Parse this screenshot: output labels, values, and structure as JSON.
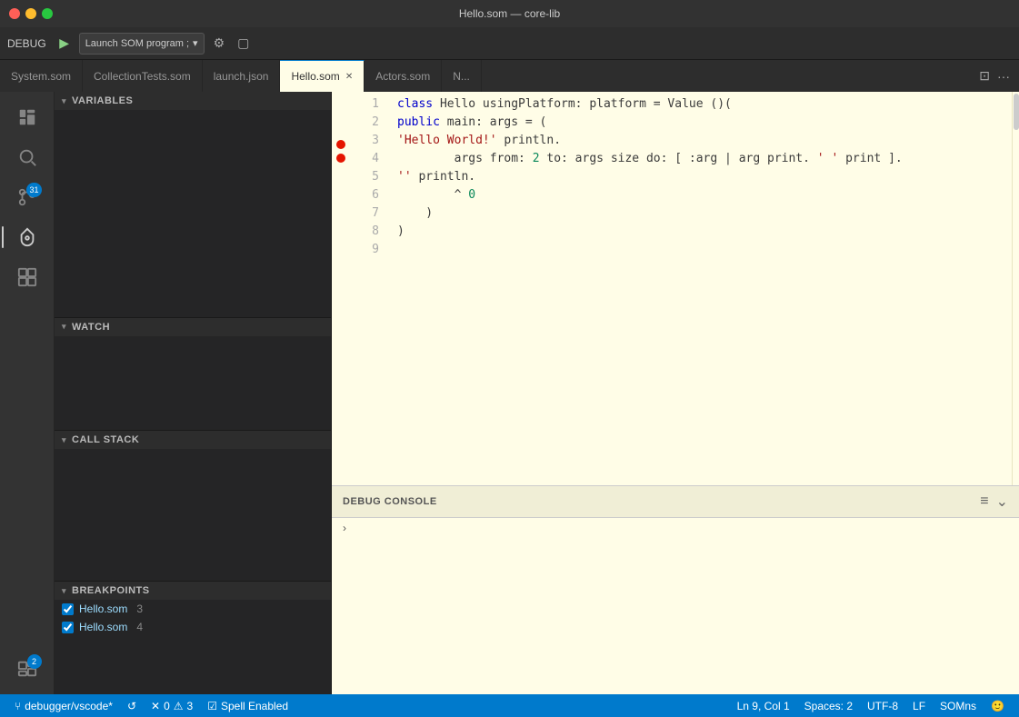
{
  "window": {
    "title": "Hello.som — core-lib"
  },
  "titlebar": {
    "buttons": [
      "close",
      "minimize",
      "maximize"
    ]
  },
  "toolbar": {
    "debug_label": "DEBUG",
    "config_name": "Launch SOM program ;",
    "gear_icon": "⚙",
    "layout_icon": "⊡"
  },
  "tabs": [
    {
      "id": "system",
      "label": "System.som",
      "active": false,
      "dirty": false
    },
    {
      "id": "collection",
      "label": "CollectionTests.som",
      "active": false,
      "dirty": false
    },
    {
      "id": "launch",
      "label": "launch.json",
      "active": false,
      "dirty": false
    },
    {
      "id": "hello",
      "label": "Hello.som",
      "active": true,
      "dirty": false
    },
    {
      "id": "actors",
      "label": "Actors.som",
      "active": false,
      "dirty": false
    },
    {
      "id": "more",
      "label": "N...",
      "active": false,
      "dirty": false
    }
  ],
  "sidebar": {
    "icons": [
      {
        "id": "explorer",
        "symbol": "⬜",
        "active": false,
        "badge": null
      },
      {
        "id": "search",
        "symbol": "🔍",
        "active": false,
        "badge": null
      },
      {
        "id": "git",
        "symbol": "⑂",
        "active": false,
        "badge": 31,
        "badge_type": "blue"
      },
      {
        "id": "debug",
        "symbol": "🐛",
        "active": true,
        "badge": null
      },
      {
        "id": "extensions",
        "symbol": "⊞",
        "active": false,
        "badge": null
      },
      {
        "id": "remote",
        "symbol": "❐",
        "active": false,
        "badge": 2,
        "badge_type": "blue"
      }
    ]
  },
  "variables_panel": {
    "label": "VARIABLES",
    "items": []
  },
  "watch_panel": {
    "label": "WATCH",
    "items": []
  },
  "callstack_panel": {
    "label": "CALL STACK",
    "items": []
  },
  "breakpoints_panel": {
    "label": "BREAKPOINTS",
    "items": [
      {
        "file": "Hello.som",
        "line": "3",
        "checked": true
      },
      {
        "file": "Hello.som",
        "line": "4",
        "checked": true
      }
    ]
  },
  "editor": {
    "lines": [
      {
        "num": 1,
        "code": "class Hello usingPlatform: platform = Value ()(",
        "breakpoint": false
      },
      {
        "num": 2,
        "code": "    public main: args = (",
        "breakpoint": false
      },
      {
        "num": 3,
        "code": "        'Hello World!' println.",
        "breakpoint": true
      },
      {
        "num": 4,
        "code": "        args from: 2 to: args size do: [ :arg | arg print. ' ' print ].",
        "breakpoint": true
      },
      {
        "num": 5,
        "code": "        '' println.",
        "breakpoint": false
      },
      {
        "num": 6,
        "code": "        ^ 0",
        "breakpoint": false
      },
      {
        "num": 7,
        "code": "    )",
        "breakpoint": false
      },
      {
        "num": 8,
        "code": ")",
        "breakpoint": false
      },
      {
        "num": 9,
        "code": "",
        "breakpoint": false
      }
    ]
  },
  "debug_console": {
    "title": "DEBUG CONSOLE",
    "chevron": "›"
  },
  "status_bar": {
    "git_branch": "debugger/vscode*",
    "sync_icon": "↺",
    "errors": "0",
    "warnings": "3",
    "error_icon": "✕",
    "warning_icon": "⚠",
    "spell": "Spell Enabled",
    "position": "Ln 9, Col 1",
    "spaces": "Spaces: 2",
    "encoding": "UTF-8",
    "line_ending": "LF",
    "language": "SOMns",
    "smiley": "🙂"
  }
}
